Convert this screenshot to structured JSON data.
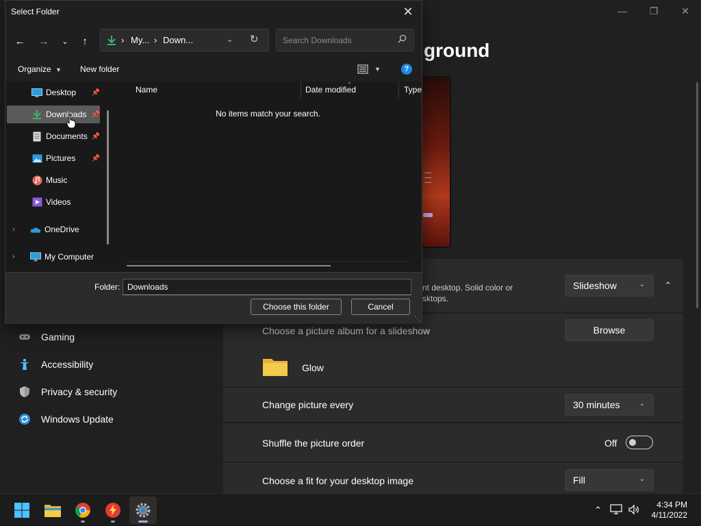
{
  "settings": {
    "title": "ground",
    "nav_items": [
      {
        "label": "Gaming",
        "icon": "gamepad-icon"
      },
      {
        "label": "Accessibility",
        "icon": "accessibility-icon"
      },
      {
        "label": "Privacy & security",
        "icon": "shield-icon"
      },
      {
        "label": "Windows Update",
        "icon": "update-icon"
      }
    ],
    "personalize": {
      "description_line1": "nt desktop. Solid color or",
      "description_line2": "sktops.",
      "dropdown_value": "Slideshow"
    },
    "album": {
      "label": "Choose a picture album for a slideshow",
      "browse_label": "Browse",
      "folder_name": "Glow"
    },
    "change_picture": {
      "label": "Change picture every",
      "value": "30 minutes"
    },
    "shuffle": {
      "label": "Shuffle the picture order",
      "state": "Off"
    },
    "fit": {
      "label": "Choose a fit for your desktop image",
      "value": "Fill"
    }
  },
  "dialog": {
    "title": "Select Folder",
    "address": {
      "segment1": "My...",
      "segment2": "Down..."
    },
    "search_placeholder": "Search Downloads",
    "organize_label": "Organize",
    "new_folder_label": "New folder",
    "tree": [
      {
        "label": "Desktop",
        "icon": "desktop-icon",
        "pinned": true,
        "selected": false
      },
      {
        "label": "Downloads",
        "icon": "download-icon",
        "pinned": true,
        "selected": true
      },
      {
        "label": "Documents",
        "icon": "document-icon",
        "pinned": true,
        "selected": false
      },
      {
        "label": "Pictures",
        "icon": "pictures-icon",
        "pinned": true,
        "selected": false
      },
      {
        "label": "Music",
        "icon": "music-icon",
        "pinned": false,
        "selected": false
      },
      {
        "label": "Videos",
        "icon": "videos-icon",
        "pinned": false,
        "selected": false
      },
      {
        "label": "OneDrive",
        "icon": "onedrive-icon",
        "pinned": false,
        "selected": false
      },
      {
        "label": "My Computer",
        "icon": "computer-icon",
        "pinned": false,
        "selected": false
      }
    ],
    "columns": [
      "Name",
      "Date modified",
      "Type"
    ],
    "empty_message": "No items match your search.",
    "folder_label": "Folder:",
    "folder_value": "Downloads",
    "choose_button": "Choose this folder",
    "cancel_button": "Cancel"
  },
  "taskbar": {
    "apps": [
      "start-icon",
      "file-explorer-icon",
      "chrome-icon",
      "app-icon",
      "settings-icon"
    ],
    "time": "4:34 PM",
    "date": "4/11/2022"
  },
  "colors": {
    "accent": "#0067c0",
    "download_green": "#3cb371",
    "selection": "#5a5a5a"
  }
}
